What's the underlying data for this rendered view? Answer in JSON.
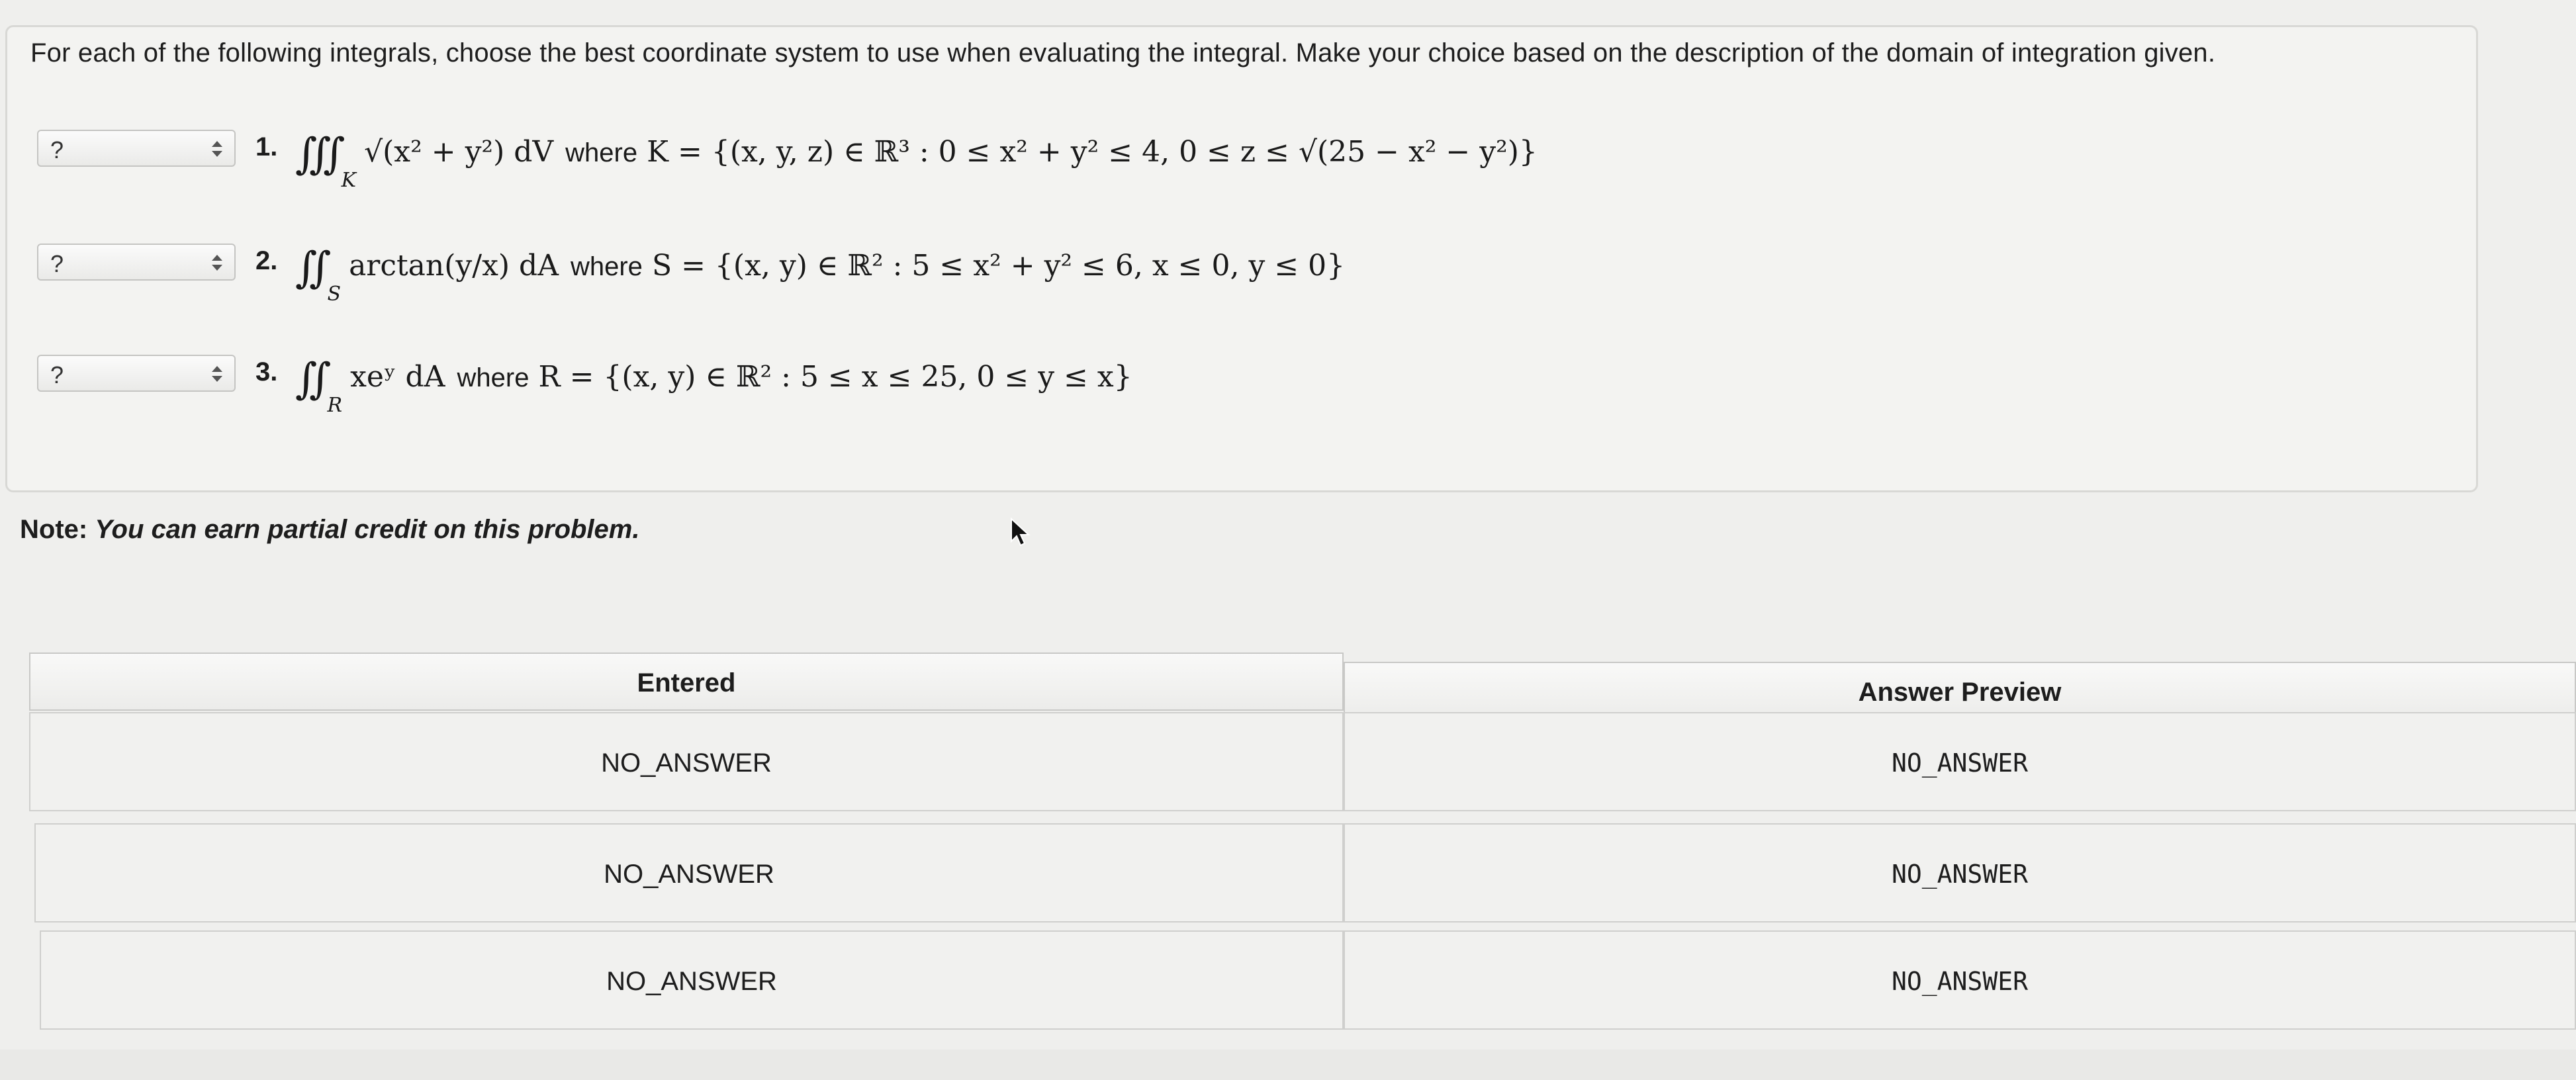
{
  "instructions": "For each of the following integrals, choose the best coordinate system to use when evaluating the integral. Make your choice based on the description of the domain of integration given.",
  "questions": [
    {
      "selected": "?",
      "number": "1.",
      "integral": "∭",
      "domain_sub": "K",
      "integrand": "√(x² + y²) dV",
      "where": "where",
      "domain": "K = {(x, y, z) ∈ ℝ³ : 0 ≤ x² + y² ≤ 4, 0 ≤ z ≤ √(25 − x² − y²)}"
    },
    {
      "selected": "?",
      "number": "2.",
      "integral": "∬",
      "domain_sub": "S",
      "integrand": "arctan(y/x) dA",
      "where": "where",
      "domain": "S = {(x, y) ∈ ℝ² : 5 ≤ x² + y² ≤ 6, x ≤ 0, y ≤ 0}"
    },
    {
      "selected": "?",
      "number": "3.",
      "integral": "∬",
      "domain_sub": "R",
      "integrand": "xeʸ dA",
      "where": "where",
      "domain": "R = {(x, y) ∈ ℝ² : 5 ≤ x ≤ 25, 0 ≤ y ≤ x}"
    }
  ],
  "note": {
    "label": "Note:",
    "text": "You can earn partial credit on this problem."
  },
  "results_table": {
    "headers": [
      "Entered",
      "Answer Preview"
    ],
    "rows": [
      {
        "entered": "NO_ANSWER",
        "preview": "NO_ANSWER"
      },
      {
        "entered": "NO_ANSWER",
        "preview": "NO_ANSWER"
      },
      {
        "entered": "NO_ANSWER",
        "preview": "NO_ANSWER"
      }
    ]
  },
  "icons": {
    "select_arrows": "up-down-chevron-icon",
    "cursor": "mouse-pointer-icon"
  }
}
